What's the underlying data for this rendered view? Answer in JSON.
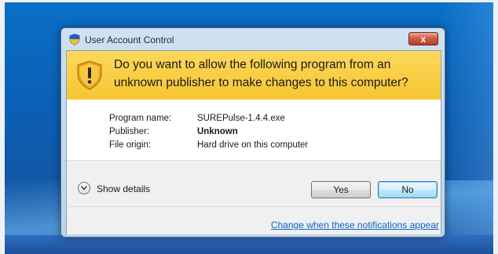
{
  "dialog": {
    "title": "User Account Control",
    "close_label": "x",
    "question": "Do you want to allow the following program from an unknown publisher to make changes to this computer?",
    "fields": [
      {
        "label": "Program name:",
        "value": "SUREPulse-1.4.4.exe"
      },
      {
        "label": "Publisher:",
        "value": "Unknown"
      },
      {
        "label": "File origin:",
        "value": "Hard drive on this computer"
      }
    ],
    "show_details": "Show details",
    "yes_label": "Yes",
    "no_label": "No",
    "notifications_link": "Change when these notifications appear"
  },
  "colors": {
    "banner": "#f7c531",
    "link": "#0a63c7",
    "close": "#c03a22",
    "desktop": "#0b5eb3"
  },
  "icons": {
    "title": "uac-shield-icon",
    "banner": "warning-shield-icon",
    "details": "chevron-down-icon"
  }
}
